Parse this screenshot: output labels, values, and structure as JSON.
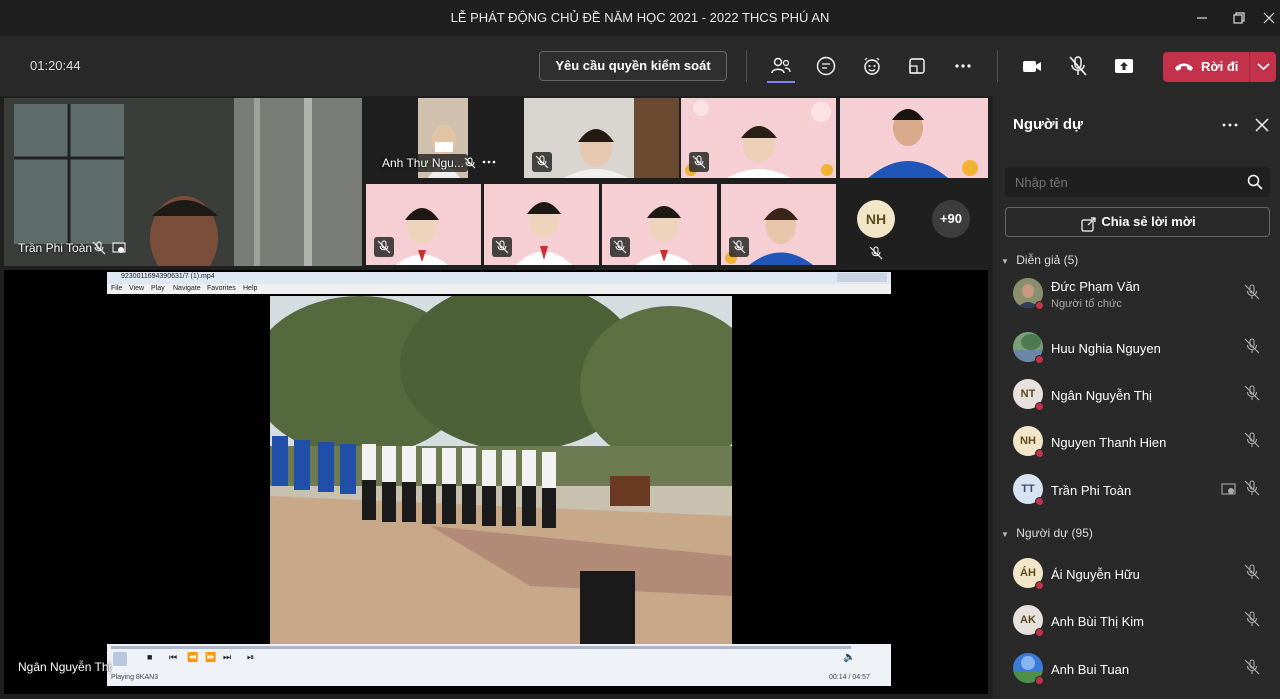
{
  "window": {
    "title": "LỄ PHÁT ĐỘNG CHỦ ĐỀ NĂM HỌC 2021 - 2022 THCS PHÚ AN"
  },
  "toolbar": {
    "timer": "01:20:44",
    "request_control_label": "Yêu cầu quyền kiểm soát",
    "leave_label": "Rời đi"
  },
  "stage": {
    "large_tile_name": "Trần Phi Toàn",
    "tile_anh_thu_name": "Anh Thư Ngu...",
    "overflow_initials": "NH",
    "overflow_count": "+90",
    "presenter_name": "Ngân Nguyễn Thị",
    "player": {
      "filename": "9230011694390631/7 (1).mp4",
      "menu": [
        "File",
        "View",
        "Play",
        "Navigate",
        "Favorites",
        "Help"
      ],
      "status": "Playing 8KAN3",
      "time": "00:14 / 04:57"
    }
  },
  "panel": {
    "title": "Người dự",
    "search_placeholder": "Nhập tên",
    "share_label": "Chia sẻ lời mời",
    "presenters_header": "Diễn giả (5)",
    "attendees_header": "Người dự (95)",
    "presenters": [
      {
        "name": "Đức Phạm Văn",
        "role": "Người tổ chức",
        "initials": "",
        "color": "#6d7a52"
      },
      {
        "name": "Huu Nghia Nguyen",
        "role": "",
        "initials": "",
        "color": "#6e8f6a"
      },
      {
        "name": "Ngân Nguyễn Thị",
        "role": "",
        "initials": "NT",
        "color": "#e6e1dc"
      },
      {
        "name": "Nguyen Thanh Hien",
        "role": "",
        "initials": "NH",
        "color": "#f2e6c9"
      },
      {
        "name": "Trần Phi Toàn",
        "role": "",
        "initials": "TT",
        "color": "#d7e3f2"
      }
    ],
    "attendees": [
      {
        "name": "Ái Nguyễn Hữu",
        "initials": "ÁH",
        "color": "#f2e6c9"
      },
      {
        "name": "Anh Bùi Thị Kim",
        "initials": "AK",
        "color": "#e6e1dc"
      },
      {
        "name": "Anh Bui Tuan",
        "initials": "",
        "color": "#3a7bd5"
      }
    ]
  },
  "colors": {
    "leave": "#c4314b",
    "accent": "#6264a7",
    "panel_bg": "#292929",
    "stage_bg": "#1f1f1f"
  }
}
